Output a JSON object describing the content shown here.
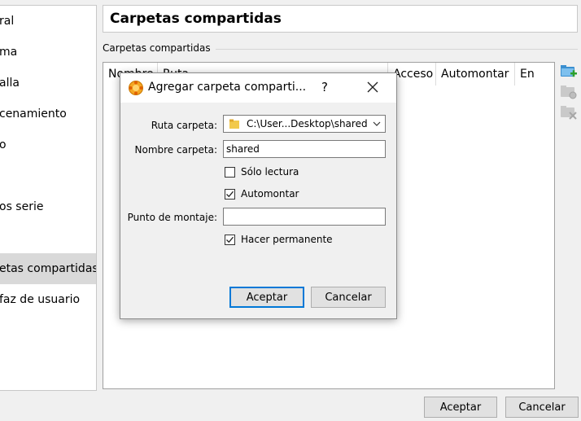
{
  "sidebar": {
    "items": [
      {
        "label": "ral"
      },
      {
        "label": "ma"
      },
      {
        "label": "alla"
      },
      {
        "label": "cenamiento"
      },
      {
        "label": "o"
      },
      {
        "label": ""
      },
      {
        "label": "os serie"
      },
      {
        "label": ""
      },
      {
        "label": "etas compartidas"
      },
      {
        "label": "faz de usuario"
      }
    ]
  },
  "header": {
    "title": "Carpetas compartidas"
  },
  "group": {
    "label": "Carpetas compartidas"
  },
  "table": {
    "columns": [
      "Nombre",
      "Ruta",
      "Acceso",
      "Automontar",
      "En"
    ]
  },
  "buttons": {
    "ok": "Aceptar",
    "cancel": "Cancelar"
  },
  "dialog": {
    "title": "Agregar carpeta comparti...",
    "help": "?",
    "fields": {
      "path_label": "Ruta carpeta:",
      "path_value": "C:\\User...Desktop\\shared",
      "name_label": "Nombre carpeta:",
      "name_value": "shared",
      "readonly_label": "Sólo lectura",
      "readonly_checked": false,
      "automount_label": "Automontar",
      "automount_checked": true,
      "mountpoint_label": "Punto de montaje:",
      "mountpoint_value": "",
      "permanent_label": "Hacer permanente",
      "permanent_checked": true
    },
    "ok": "Aceptar",
    "cancel": "Cancelar"
  },
  "colors": {
    "accent": "#0078d7",
    "selection": "#d9d9d9"
  }
}
